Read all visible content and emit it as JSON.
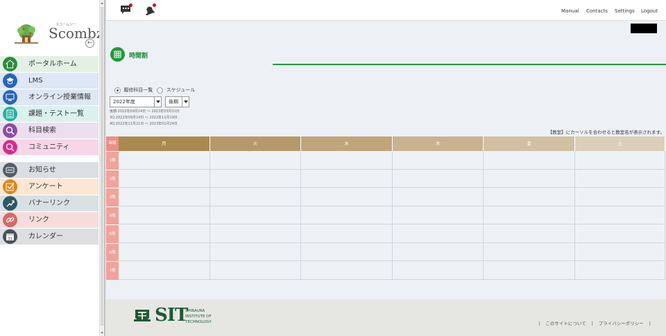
{
  "sidebar": {
    "logo_text": "Scombz",
    "logo_sub": "スコームジー",
    "back_icon": "arrow-left-icon",
    "items": [
      {
        "label": "ポータルホーム",
        "icon": "home-icon",
        "icon_color": "#2e8b3a",
        "bg": "#e2f1e4"
      },
      {
        "label": "LMS",
        "icon": "graduation-cap-icon",
        "icon_color": "#2a65b8",
        "bg": "#dde7f5"
      },
      {
        "label": "オンライン授業情報",
        "icon": "monitor-icon",
        "icon_color": "#2a65b8",
        "bg": "#dde7f5"
      },
      {
        "label": "課題・テスト一覧",
        "icon": "checklist-icon",
        "icon_color": "#2ab0a0",
        "bg": "#daf1ee"
      },
      {
        "label": "科目検索",
        "icon": "search-icon",
        "icon_color": "#8b4ea6",
        "bg": "#ecdff0"
      },
      {
        "label": "コミュニティ",
        "icon": "community-search-icon",
        "icon_color": "#d72c8c",
        "bg": "#f6d6e7"
      },
      {
        "label": "お知らせ",
        "icon": "news-icon",
        "icon_color": "#555d66",
        "bg": "#dcdfe2"
      },
      {
        "label": "アンケート",
        "icon": "survey-check-icon",
        "icon_color": "#e0841a",
        "bg": "#fbe7d2"
      },
      {
        "label": "バナーリンク",
        "icon": "banner-link-icon",
        "icon_color": "#2e5a63",
        "bg": "#d7e1e3"
      },
      {
        "label": "リンク",
        "icon": "chain-link-icon",
        "icon_color": "#d26a6a",
        "bg": "#f6dcdc"
      },
      {
        "label": "カレンダー",
        "icon": "calendar-icon",
        "icon_color": "#4a5058",
        "bg": "#dcdee0"
      }
    ]
  },
  "topbar": {
    "icons": [
      "chat-icon",
      "bell-icon"
    ],
    "links": [
      "Manual",
      "Contacts",
      "Settings",
      "Logout"
    ]
  },
  "page": {
    "title": "時間割",
    "title_icon": "grid-icon",
    "radio_options": [
      {
        "label": "履修科目一覧",
        "selected": true
      },
      {
        "label": "スケジュール",
        "selected": false
      }
    ],
    "year_select": "2022年度",
    "term_select": "後期",
    "periods": [
      "後期:2022年09月24日 ～ 2023年03月31日",
      "3Q:2022年09月24日 ～ 2022年11月19日",
      "4Q:2022年11月21日 ～ 2023年01月24日"
    ],
    "hint": "【教室】にカーソルを合わせると教室名が表示されます。"
  },
  "timetable": {
    "corner_label": "時限",
    "days": [
      {
        "label": "月",
        "color": "#a98a4e"
      },
      {
        "label": "火",
        "color": "#b6996a"
      },
      {
        "label": "水",
        "color": "#c0a57a"
      },
      {
        "label": "木",
        "color": "#c9b290"
      },
      {
        "label": "金",
        "color": "#d2c0a3"
      },
      {
        "label": "土",
        "color": "#dccfba"
      }
    ],
    "periods": [
      "1限",
      "2限",
      "3限",
      "4限",
      "5限",
      "6限",
      "7限"
    ]
  },
  "footer": {
    "logo_mark": "sit-emblem-icon",
    "logo_text": "SIT",
    "logo_sub": [
      "SHIBAURA",
      "INSTITUTE OF",
      "TECHNOLOGY"
    ],
    "links": [
      "このサイトについて",
      "プライバシーポリシー"
    ]
  }
}
